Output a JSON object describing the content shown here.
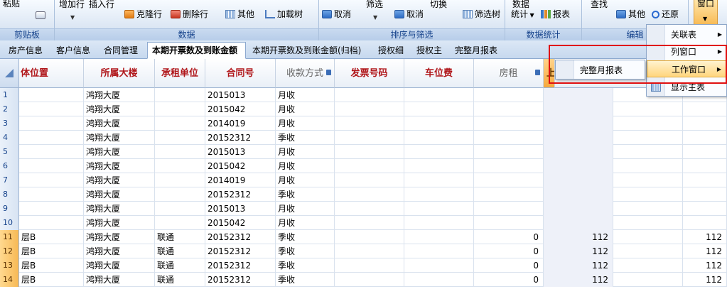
{
  "ribbon": {
    "clipboard": {
      "paste": "粘贴",
      "group_label": "剪贴板"
    },
    "data": {
      "add_row": "增加行",
      "insert_row": "插入行",
      "clone_row": "克隆行",
      "delete_row": "删除行",
      "other": "其他",
      "load_tree": "加载树",
      "group_label": "数据"
    },
    "sort": {
      "cancel_sort": "取消",
      "filter": "筛选",
      "cancel_filter": "取消",
      "toggle": "切换",
      "filter_tree": "筛选树",
      "group_label": "排序与筛选"
    },
    "stats": {
      "data_stats_1": "数据",
      "data_stats_2": "统计",
      "report": "报表",
      "group_label": "数据统计"
    },
    "edit": {
      "find": "查找",
      "other": "其他",
      "restore": "还原",
      "group_label": "编辑"
    },
    "window": {
      "label": "窗口"
    }
  },
  "tabs": [
    {
      "label": "房产信息"
    },
    {
      "label": "客户信息"
    },
    {
      "label": "合同管理"
    },
    {
      "label": "本期开票数及到账金额"
    },
    {
      "label": "本期开票数及到账金额(归档)"
    },
    {
      "label": "授权细"
    },
    {
      "label": "授权主"
    },
    {
      "label": "完整月报表"
    }
  ],
  "grid": {
    "headers": [
      {
        "label": "体位置"
      },
      {
        "label": "所属大楼"
      },
      {
        "label": "承租单位"
      },
      {
        "label": "合同号"
      },
      {
        "label": "收款方式"
      },
      {
        "label": "发票号码"
      },
      {
        "label": "车位费"
      },
      {
        "label": "房租"
      },
      {
        "label": "上"
      }
    ],
    "rows": [
      {
        "n": "1",
        "pos": "",
        "bld": "鸿翔大厦",
        "ten": "",
        "con": "2015013",
        "pay": "月收",
        "rent": "",
        "amt": "",
        "amt2": ""
      },
      {
        "n": "2",
        "pos": "",
        "bld": "鸿翔大厦",
        "ten": "",
        "con": "2015042",
        "pay": "月收",
        "rent": "",
        "amt": "",
        "amt2": ""
      },
      {
        "n": "3",
        "pos": "",
        "bld": "鸿翔大厦",
        "ten": "",
        "con": "2014019",
        "pay": "月收",
        "rent": "",
        "amt": "",
        "amt2": ""
      },
      {
        "n": "4",
        "pos": "",
        "bld": "鸿翔大厦",
        "ten": "",
        "con": "20152312",
        "pay": "季收",
        "rent": "",
        "amt": "",
        "amt2": ""
      },
      {
        "n": "5",
        "pos": "",
        "bld": "鸿翔大厦",
        "ten": "",
        "con": "2015013",
        "pay": "月收",
        "rent": "",
        "amt": "",
        "amt2": ""
      },
      {
        "n": "6",
        "pos": "",
        "bld": "鸿翔大厦",
        "ten": "",
        "con": "2015042",
        "pay": "月收",
        "rent": "",
        "amt": "",
        "amt2": ""
      },
      {
        "n": "7",
        "pos": "",
        "bld": "鸿翔大厦",
        "ten": "",
        "con": "2014019",
        "pay": "月收",
        "rent": "",
        "amt": "",
        "amt2": ""
      },
      {
        "n": "8",
        "pos": "",
        "bld": "鸿翔大厦",
        "ten": "",
        "con": "20152312",
        "pay": "季收",
        "rent": "",
        "amt": "",
        "amt2": ""
      },
      {
        "n": "9",
        "pos": "",
        "bld": "鸿翔大厦",
        "ten": "",
        "con": "2015013",
        "pay": "月收",
        "rent": "",
        "amt": "",
        "amt2": ""
      },
      {
        "n": "10",
        "pos": "",
        "bld": "鸿翔大厦",
        "ten": "",
        "con": "2015042",
        "pay": "月收",
        "rent": "",
        "amt": "",
        "amt2": ""
      },
      {
        "n": "11",
        "pos": "层B",
        "bld": "鸿翔大厦",
        "ten": "联通",
        "con": "20152312",
        "pay": "季收",
        "rent": "0",
        "amt": "112",
        "amt2": "112"
      },
      {
        "n": "12",
        "pos": "层B",
        "bld": "鸿翔大厦",
        "ten": "联通",
        "con": "20152312",
        "pay": "季收",
        "rent": "0",
        "amt": "112",
        "amt2": "112"
      },
      {
        "n": "13",
        "pos": "层B",
        "bld": "鸿翔大厦",
        "ten": "联通",
        "con": "20152312",
        "pay": "季收",
        "rent": "0",
        "amt": "112",
        "amt2": "112"
      },
      {
        "n": "14",
        "pos": "层B",
        "bld": "鸿翔大厦",
        "ten": "联通",
        "con": "20152312",
        "pay": "季收",
        "rent": "0",
        "amt": "112",
        "amt2": "112"
      }
    ]
  },
  "window_menu": {
    "items": [
      {
        "label": "关联表"
      },
      {
        "label": "列窗口"
      },
      {
        "label": "工作窗口"
      },
      {
        "label": "显示主表"
      }
    ]
  },
  "work_window_submenu": {
    "items": [
      {
        "label": "完整月报表"
      }
    ]
  }
}
